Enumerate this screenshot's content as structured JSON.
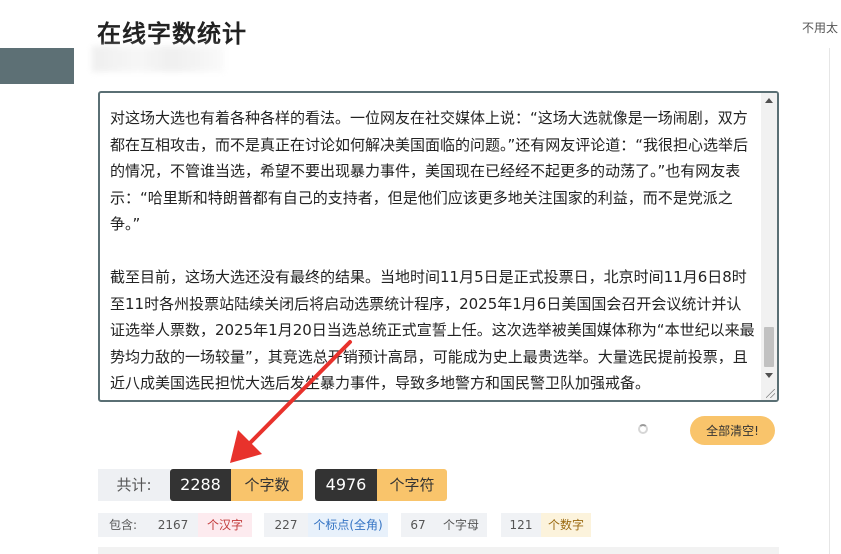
{
  "page": {
    "title": "在线字数统计",
    "right_hint": "不用太"
  },
  "editor": {
    "text": "对这场大选也有着各种各样的看法。一位网友在社交媒体上说：“这场大选就像是一场闹剧，双方都在互相攻击，而不是真正在讨论如何解决美国面临的问题。”还有网友评论道：“我很担心选举后的情况，不管谁当选，希望不要出现暴力事件，美国现在已经经不起更多的动荡了。”也有网友表示：“哈里斯和特朗普都有自己的支持者，但是他们应该更多地关注国家的利益，而不是党派之争。”\n\n截至目前，这场大选还没有最终的结果。当地时间11月5日是正式投票日，北京时间11月6日8时至11时各州投票站陆续关闭后将启动选票统计程序，2025年1月6日美国国会召开会议统计并认证选举人票数，2025年1月20日当选总统正式宣誓上任。这次选举被美国媒体称为“本世纪以来最势均力敌的一场较量”，其竞选总开销预计高昂，可能成为史上最贵选举。大量选民提前投票，且近八成美国选民担忧大选后发生暴力事件，导致多地警方和国民警卫队加强戒备。"
  },
  "actions": {
    "clear_all": "全部清空!"
  },
  "stats": {
    "total_label": "共计:",
    "word_count": "2288",
    "word_unit": "个字数",
    "char_count": "4976",
    "char_unit": "个字符"
  },
  "details": {
    "label": "包含:",
    "hanzi_count": "2167",
    "hanzi_unit": "个汉字",
    "punct_count": "227",
    "punct_unit": "个标点(全角)",
    "letter_count": "67",
    "letter_unit": "个字母",
    "digit_count": "121",
    "digit_unit": "个数字"
  },
  "colors": {
    "accent": "#f9c46b",
    "dark": "#333333",
    "editor_border": "#5a6f74",
    "arrow": "#e8322c"
  }
}
